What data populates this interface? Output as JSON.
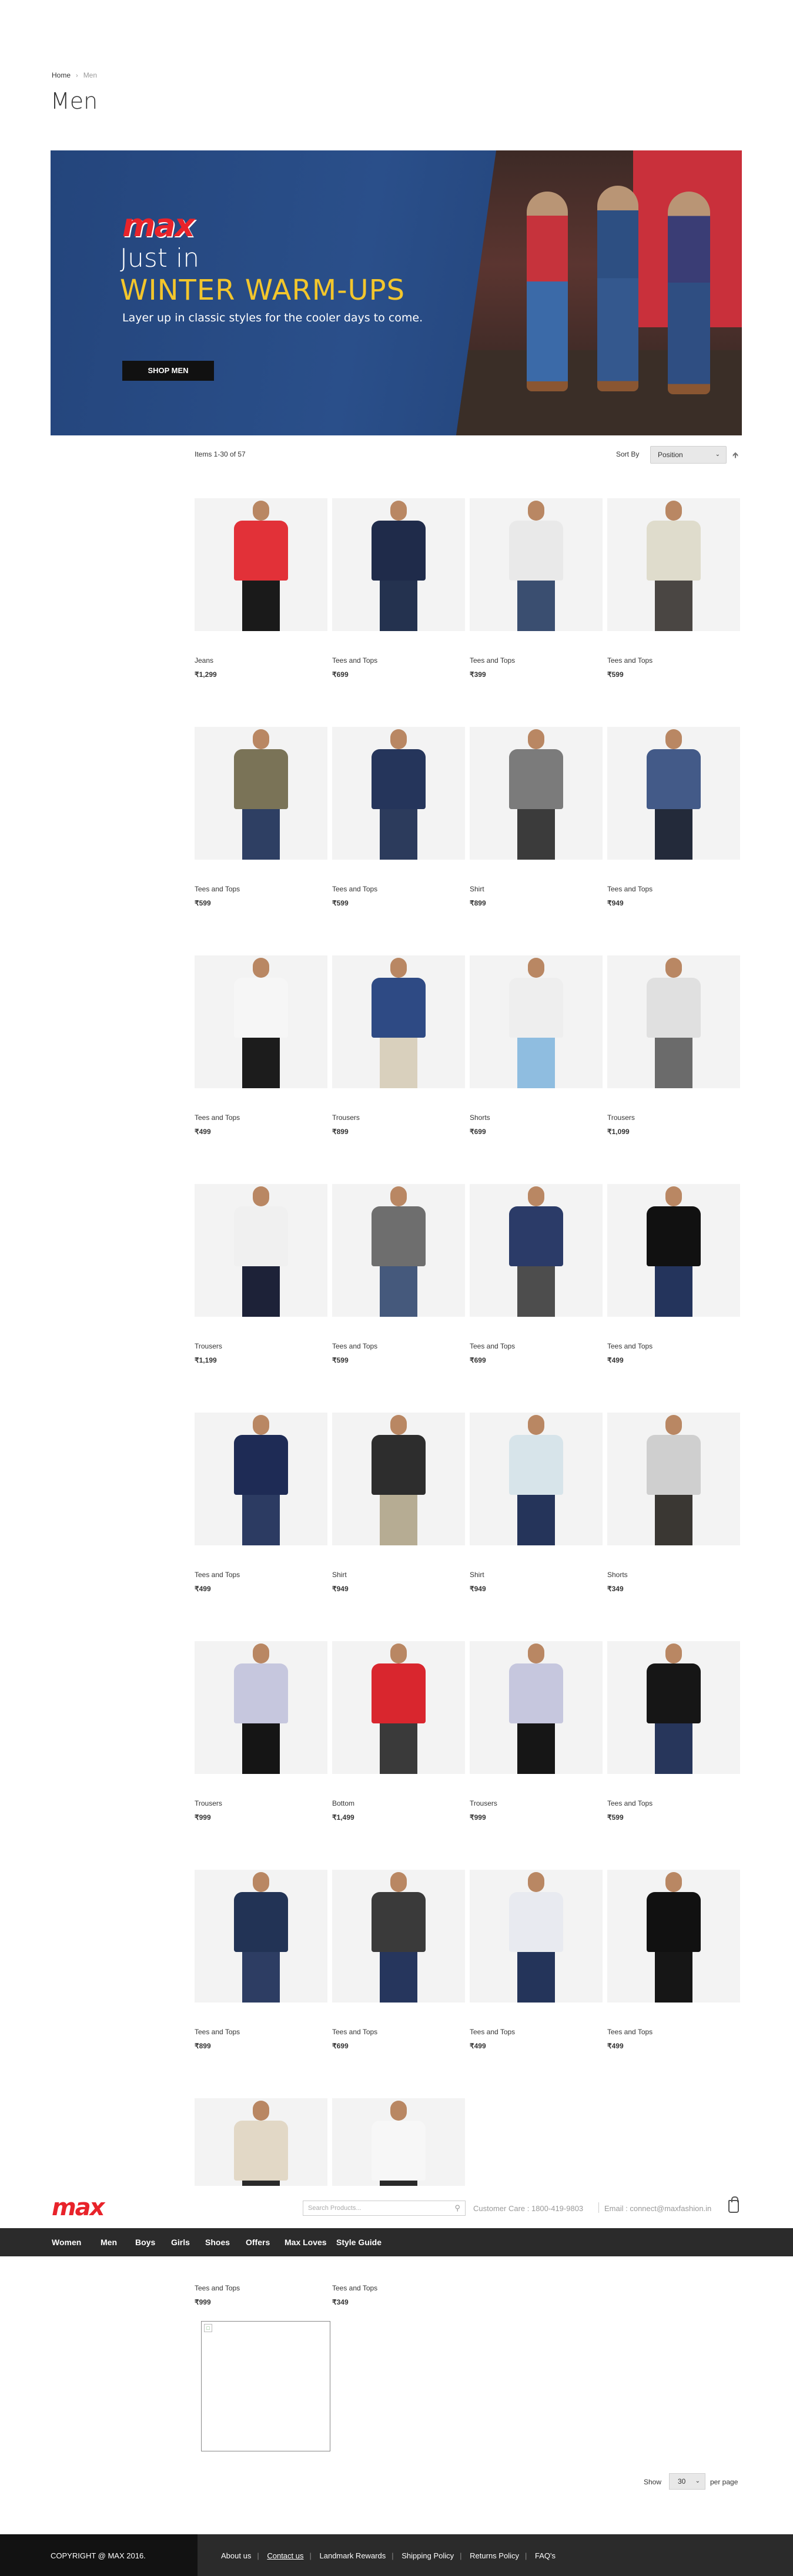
{
  "breadcrumb": {
    "home": "Home",
    "separator": "›",
    "current": "Men"
  },
  "page_title": "Men",
  "banner": {
    "brand": "max",
    "line1": "Just in",
    "line2": "WINTER WARM-UPS",
    "line3": "Layer up in classic styles for the cooler days to come.",
    "button": "SHOP MEN"
  },
  "toolbar": {
    "items_count": "Items 1-30 of 57",
    "sort_label": "Sort By",
    "sort_value": "Position",
    "sort_direction_icon": "arrow-up-icon"
  },
  "products": [
    {
      "name": "Jeans",
      "price": "₹1,299",
      "top": "#e23138",
      "bottom": "#1a1a1a"
    },
    {
      "name": "Tees and Tops",
      "price": "₹699",
      "top": "#1f2b4a",
      "bottom": "#24324f"
    },
    {
      "name": "Tees and Tops",
      "price": "₹399",
      "top": "#e9e9e9",
      "bottom": "#3a4e70"
    },
    {
      "name": "Tees and Tops",
      "price": "₹599",
      "top": "#dfdccc",
      "bottom": "#4a4643"
    },
    {
      "name": "Tees and Tops",
      "price": "₹599",
      "top": "#7a7357",
      "bottom": "#2e3f63"
    },
    {
      "name": "Tees and Tops",
      "price": "₹599",
      "top": "#25355b",
      "bottom": "#2c3b5c"
    },
    {
      "name": "Shirt",
      "price": "₹899",
      "top": "#7b7b7b",
      "bottom": "#3b3b3b"
    },
    {
      "name": "Tees and Tops",
      "price": "₹949",
      "top": "#435a88",
      "bottom": "#232a3a"
    },
    {
      "name": "Tees and Tops",
      "price": "₹499",
      "top": "#f6f6f6",
      "bottom": "#1c1c1c"
    },
    {
      "name": "Trousers",
      "price": "₹899",
      "top": "#2e4a84",
      "bottom": "#d9d0bd"
    },
    {
      "name": "Shorts",
      "price": "₹699",
      "top": "#eeeeee",
      "bottom": "#8fbde0"
    },
    {
      "name": "Trousers",
      "price": "₹1,099",
      "top": "#e0e0e0",
      "bottom": "#6b6b6b"
    },
    {
      "name": "Trousers",
      "price": "₹1,199",
      "top": "#f0f0f0",
      "bottom": "#1d2238"
    },
    {
      "name": "Tees and Tops",
      "price": "₹599",
      "top": "#6e6e6e",
      "bottom": "#45597c"
    },
    {
      "name": "Tees and Tops",
      "price": "₹699",
      "top": "#2b3b68",
      "bottom": "#4d4d4d"
    },
    {
      "name": "Tees and Tops",
      "price": "₹499",
      "top": "#111111",
      "bottom": "#24345c"
    },
    {
      "name": "Tees and Tops",
      "price": "₹499",
      "top": "#1e2b55",
      "bottom": "#2c3b62"
    },
    {
      "name": "Shirt",
      "price": "₹949",
      "top": "#2d2d2d",
      "bottom": "#b6ac93"
    },
    {
      "name": "Shirt",
      "price": "₹949",
      "top": "#d7e4ea",
      "bottom": "#25345a"
    },
    {
      "name": "Shorts",
      "price": "₹349",
      "top": "#cfcfcf",
      "bottom": "#3a3733"
    },
    {
      "name": "Trousers",
      "price": "₹999",
      "top": "#c6c7de",
      "bottom": "#151515"
    },
    {
      "name": "Bottom",
      "price": "₹1,499",
      "top": "#d9262e",
      "bottom": "#3a3a3a"
    },
    {
      "name": "Trousers",
      "price": "₹999",
      "top": "#c6c7de",
      "bottom": "#161616"
    },
    {
      "name": "Tees and Tops",
      "price": "₹599",
      "top": "#161616",
      "bottom": "#27365b"
    },
    {
      "name": "Tees and Tops",
      "price": "₹899",
      "top": "#223355",
      "bottom": "#2d3d63"
    },
    {
      "name": "Tees and Tops",
      "price": "₹699",
      "top": "#3a3a3a",
      "bottom": "#26365d"
    },
    {
      "name": "Tees and Tops",
      "price": "₹499",
      "top": "#e8eaf0",
      "bottom": "#24345a"
    },
    {
      "name": "Tees and Tops",
      "price": "₹499",
      "top": "#111111",
      "bottom": "#161616"
    },
    {
      "name": "Tees and Tops",
      "price": "₹999",
      "top": "#e2d8c6",
      "bottom": "#2a2a2a"
    },
    {
      "name": "Tees and Tops",
      "price": "₹349",
      "top": "#f7f7f7",
      "bottom": "#2a2a2a"
    }
  ],
  "header": {
    "logo": "max",
    "search_placeholder": "Search Products...",
    "customer_care": "Customer Care : 1800-419-9803",
    "email": "Email : connect@maxfashion.in",
    "cart_icon": "shopping-bag-icon",
    "nav": [
      "Women",
      "Men",
      "Boys",
      "Girls",
      "Shoes",
      "Offers",
      "Max Loves",
      "Style Guide"
    ]
  },
  "pagination": {
    "show_label": "Show",
    "limit": "30",
    "per_page": "per page"
  },
  "footer": {
    "copyright": "COPYRIGHT @ MAX 2016.",
    "links": [
      "About us",
      "Contact us",
      "Landmark Rewards",
      "Shipping Policy",
      "Returns Policy",
      "FAQ's"
    ]
  },
  "colors": {
    "brand_red": "#e8232a",
    "brand_blue": "#1f3f8f",
    "banner_blue": "#27487f",
    "banner_yellow": "#f3c62c",
    "nav_bg": "#2b2b2b"
  }
}
